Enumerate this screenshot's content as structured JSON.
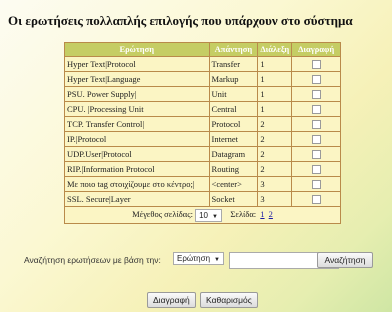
{
  "page": {
    "title": "Οι ερωτήσεις πολλαπλής επιλογής που υπάρχουν στο σύστημα"
  },
  "table": {
    "headers": [
      "Ερώτηση",
      "Απάντηση",
      "Διάλεξη",
      "Διαγραφή"
    ],
    "rows": [
      {
        "question": "Hyper Text|Protocol",
        "answer": "Transfer",
        "lecture": "1"
      },
      {
        "question": "Hyper Text|Language",
        "answer": "Markup",
        "lecture": "1"
      },
      {
        "question": "PSU. Power Supply|",
        "answer": "Unit",
        "lecture": "1"
      },
      {
        "question": "CPU. |Processing Unit",
        "answer": "Central",
        "lecture": "1"
      },
      {
        "question": "TCP. Transfer Control|",
        "answer": "Protocol",
        "lecture": "2"
      },
      {
        "question": "IP.|Protocol",
        "answer": "Internet",
        "lecture": "2"
      },
      {
        "question": "UDP.User|Protocol",
        "answer": "Datagram",
        "lecture": "2"
      },
      {
        "question": "RIP.|Information Protocol",
        "answer": "Routing",
        "lecture": "2"
      },
      {
        "question": "Με ποιο tag στοιχίζουμε στο κέντρο;|",
        "answer": "<center>",
        "lecture": "3"
      },
      {
        "question": "SSL. Secure|Layer",
        "answer": "Socket",
        "lecture": "3"
      }
    ],
    "footer": {
      "page_size_label": "Μέγεθος σελίδας:",
      "page_size_value": "10",
      "pages_label": "Σελίδα:",
      "pages": [
        "1",
        "2"
      ]
    }
  },
  "search": {
    "label": "Αναζήτηση ερωτήσεων με βάση την:",
    "field_value": "Ερώτηση",
    "input_value": "",
    "button_label": "Αναζήτηση"
  },
  "actions": {
    "delete_label": "Διαγραφή",
    "clear_label": "Καθαρισμός"
  }
}
